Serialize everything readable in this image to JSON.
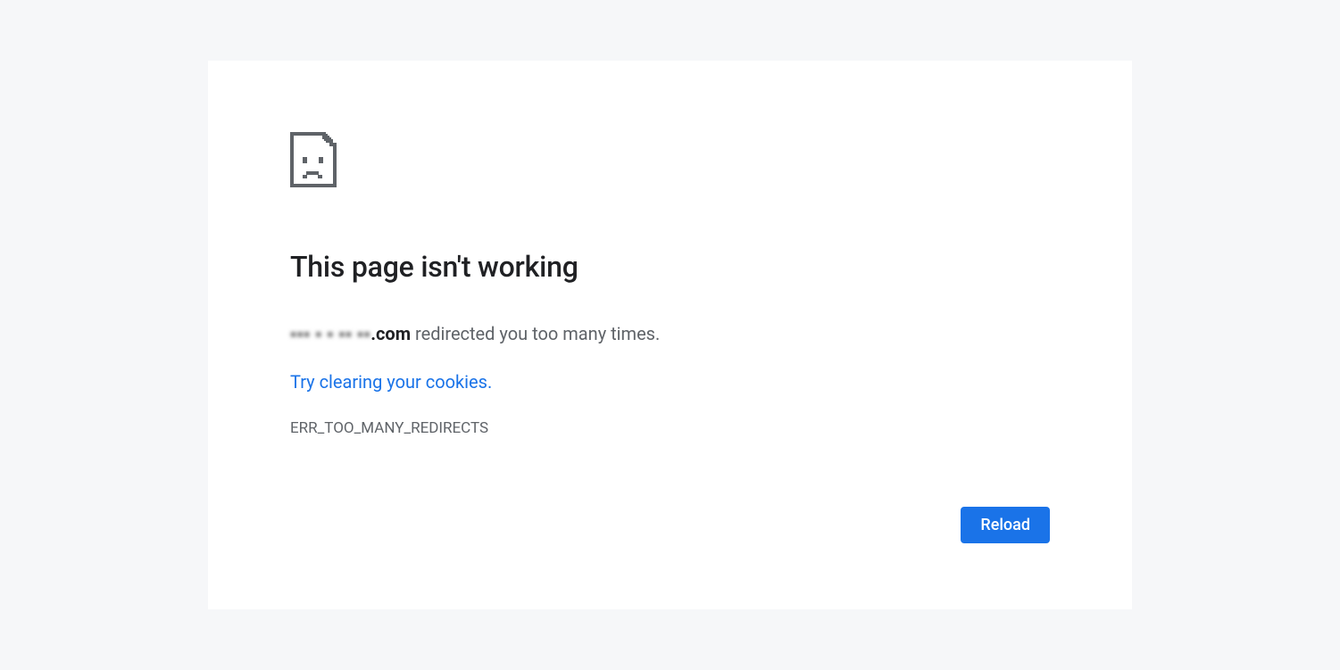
{
  "error": {
    "heading": "This page isn't working",
    "domain_obscured": "▪▪▪ ▪ ▪ ▪▪ ▪▪",
    "domain_suffix": ".com",
    "message_suffix": " redirected you too many times.",
    "suggestion_link": "Try clearing your cookies",
    "suggestion_period": ".",
    "code": "ERR_TOO_MANY_REDIRECTS",
    "reload_label": "Reload"
  }
}
